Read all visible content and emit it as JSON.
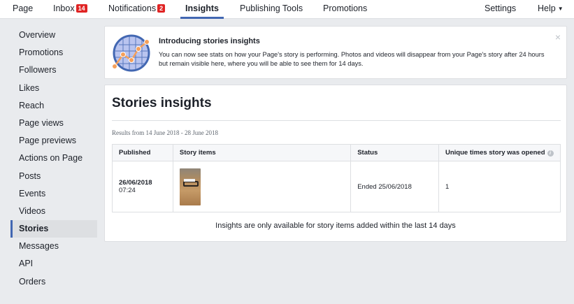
{
  "topnav": {
    "items": [
      {
        "label": "Page"
      },
      {
        "label": "Inbox",
        "badge": "14"
      },
      {
        "label": "Notifications",
        "badge": "2"
      },
      {
        "label": "Insights",
        "active": true
      },
      {
        "label": "Publishing Tools"
      },
      {
        "label": "Promotions"
      }
    ],
    "settings_label": "Settings",
    "help_label": "Help"
  },
  "sidebar": {
    "items": [
      {
        "label": "Overview"
      },
      {
        "label": "Promotions"
      },
      {
        "label": "Followers"
      },
      {
        "label": "Likes"
      },
      {
        "label": "Reach"
      },
      {
        "label": "Page views"
      },
      {
        "label": "Page previews"
      },
      {
        "label": "Actions on Page"
      },
      {
        "label": "Posts"
      },
      {
        "label": "Events"
      },
      {
        "label": "Videos"
      },
      {
        "label": "Stories",
        "active": true
      },
      {
        "label": "Messages"
      },
      {
        "label": "API"
      },
      {
        "label": "Orders"
      }
    ]
  },
  "intro": {
    "title": "Introducing stories insights",
    "text": "You can now see stats on how your Page's story is performing. Photos and videos will disappear from your Page's story after 24 hours but remain visible here, where you will be able to see them for 14 days.",
    "close_symbol": "×"
  },
  "stories": {
    "title": "Stories insights",
    "results_range": "Results from 14 June 2018 - 28 June 2018",
    "columns": [
      "Published",
      "Story items",
      "Status",
      "Unique times story was opened"
    ],
    "info_symbol": "i",
    "rows": [
      {
        "published_date": "26/06/2018",
        "published_time": "07:24",
        "status": "Ended 25/06/2018",
        "unique_opens": "1"
      }
    ],
    "footnote": "Insights are only available for story items added within the last 14 days"
  },
  "colors": {
    "accent": "#4267b2",
    "badge": "#e02424",
    "background": "#e9ebee"
  },
  "icons": {
    "intro": "chart-globe-icon",
    "help_caret": "caret-down-icon",
    "close": "close-icon",
    "info": "info-icon"
  }
}
